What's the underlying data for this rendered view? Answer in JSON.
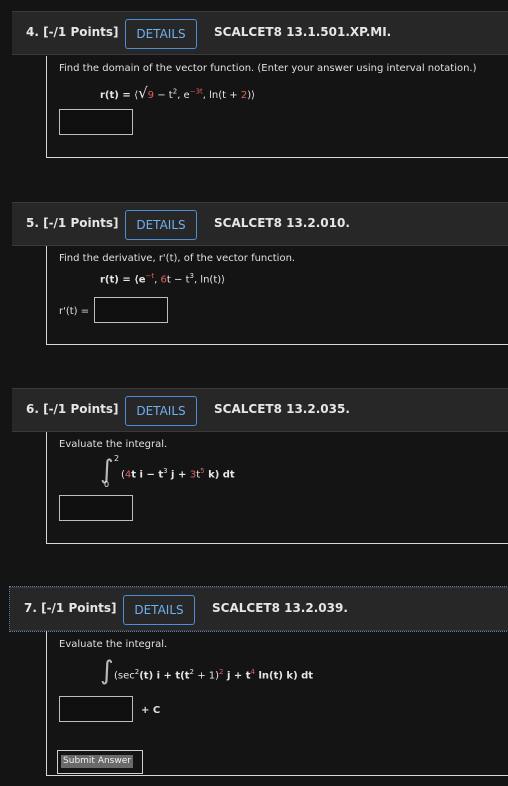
{
  "questions": [
    {
      "points": "4. [-/1 Points]",
      "details": "DETAILS",
      "code": "SCALCET8 13.1.501.XP.MI.",
      "prompt": "Find the domain of the vector function. (Enter your answer using interval notation.)",
      "formula_parts": {
        "lhs": "r(t) = ",
        "open": "⟨",
        "sqrt": "√",
        "nine": "9",
        "rest1": " − t",
        "sq": "2",
        "comma1": ", e",
        "exp": "−3t",
        "rest2": ", ln(t + ",
        "two": "2",
        "close": ")⟩"
      }
    },
    {
      "points": "5. [-/1 Points]",
      "details": "DETAILS",
      "code": "SCALCET8 13.2.010.",
      "prompt": "Find the derivative, r'(t), of the vector function.",
      "formula_parts": {
        "lhs": "r(t) = ⟨e",
        "exp": "−t",
        "comma": ", ",
        "six": "6",
        "rest": "t − t",
        "cube": "3",
        "end": ", ln(t)⟩"
      },
      "answer_label": "r'(t) ="
    },
    {
      "points": "6. [-/1 Points]",
      "details": "DETAILS",
      "code": "SCALCET8 13.2.035.",
      "prompt": "Evaluate the integral.",
      "upper": "2",
      "lower": "0",
      "formula_parts": {
        "open": "(",
        "four": "4",
        "a": "t i − t",
        "cube": "3",
        "b": " j + ",
        "three": "3",
        "c": "t",
        "five": "5",
        "d": " k) dt"
      }
    },
    {
      "points": "7. [-/1 Points]",
      "details": "DETAILS",
      "code": "SCALCET8 13.2.039.",
      "prompt": "Evaluate the integral.",
      "formula_parts": {
        "a": "(sec",
        "sq1": "2",
        "b": "(t) i + t(t",
        "sq2": "2",
        "c": " + 1)",
        "sq3": "2",
        "d": " j + t",
        "four": "4",
        "e": " ln(t) k) dt"
      },
      "plus_c": "+ C"
    }
  ],
  "submit_label": "Submit Answer"
}
